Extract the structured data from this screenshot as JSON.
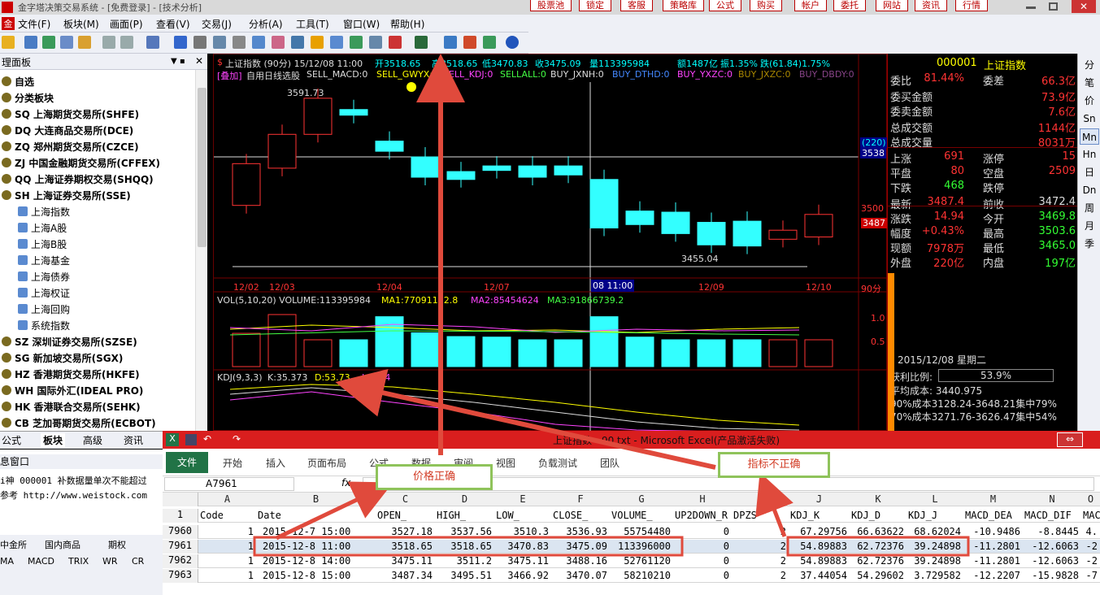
{
  "app": {
    "title": "金字塔决策交易系统 - [免费登录] - [技术分析]"
  },
  "top_buttons": [
    "股票池",
    "锁定",
    "客服",
    "策略库",
    "公式",
    "购买",
    "帐户",
    "委托",
    "网站",
    "资讯",
    "行情"
  ],
  "menu": [
    "文件(F)",
    "板块(M)",
    "画面(P)",
    "查看(V)",
    "交易(J)",
    "分析(A)",
    "工具(T)",
    "窗口(W)",
    "帮助(H)"
  ],
  "panel": {
    "title": "理面板",
    "tree": [
      {
        "label": "自选",
        "bold": true
      },
      {
        "label": "分类板块",
        "bold": true
      },
      {
        "label": "SQ 上海期货交易所(SHFE)",
        "bold": true
      },
      {
        "label": "DQ 大连商品交易所(DCE)",
        "bold": true
      },
      {
        "label": "ZQ 郑州期货交易所(CZCE)",
        "bold": true
      },
      {
        "label": "ZJ 中国金融期货交易所(CFFEX)",
        "bold": true
      },
      {
        "label": "QQ 上海证券期权交易(SHQQ)",
        "bold": true
      },
      {
        "label": "SH 上海证券交易所(SSE)",
        "bold": true
      },
      {
        "label": "上海指数",
        "bold": false
      },
      {
        "label": "上海A股",
        "bold": false
      },
      {
        "label": "上海B股",
        "bold": false
      },
      {
        "label": "上海基金",
        "bold": false
      },
      {
        "label": "上海债券",
        "bold": false
      },
      {
        "label": "上海权证",
        "bold": false
      },
      {
        "label": "上海回购",
        "bold": false
      },
      {
        "label": "系统指数",
        "bold": false
      },
      {
        "label": "SZ 深圳证券交易所(SZSE)",
        "bold": true
      },
      {
        "label": "SG 新加坡交易所(SGX)",
        "bold": true
      },
      {
        "label": "HZ 香港期货交易所(HKFE)",
        "bold": true
      },
      {
        "label": "WH 国际外汇(IDEAL PRO)",
        "bold": true
      },
      {
        "label": "HK 香港联合交易所(SEHK)",
        "bold": true
      },
      {
        "label": "CB 芝加哥期货交易所(ECBOT)",
        "bold": true
      }
    ],
    "tabs": [
      "公式",
      "板块",
      "高级",
      "资讯"
    ],
    "status_title": "息窗口",
    "status_lines": [
      "i神 000001 补数据量单次不能超过",
      "参考 http://www.weistock.com"
    ],
    "bottom_row1": [
      "中金所",
      "国内商品",
      "期权"
    ],
    "bottom_row2": [
      "MA",
      "MACD",
      "TRIX",
      "WR",
      "CR"
    ]
  },
  "chart": {
    "header": "上证指数 (90分) 15/12/08 11:00",
    "open": "开3518.65",
    "high": "高3518.65",
    "low": "低3470.83",
    "close": "收3475.09",
    "vol": "量113395984",
    "amount": "额1487亿",
    "amp": "振1.35%",
    "chg": "跌(61.84)1.75%",
    "indicators": [
      "[叠加]",
      "自用日线选股",
      "SELL_MACD:0",
      "SELL_GWYX:0",
      "SELL_KDJ:0",
      "SELLALL:0",
      "BUY_JXNH:0",
      "BUY_DTHD:0",
      "BUY_YXZC:0",
      "BUY_JXZC:0",
      "BUY_DBDY:0"
    ],
    "price_high_label": "3591.73",
    "price_low_label": "3455.04",
    "price_axis": [
      "3500",
      "3487"
    ],
    "crosshair_badge": [
      "(220)",
      "3538"
    ],
    "dates": [
      "12/02",
      "12/03",
      "12/04",
      "12/07",
      "08 11:00",
      "12/09",
      "12/10"
    ],
    "period": "90分",
    "vol_header": "VOL(5,10,20) VOLUME:113395984",
    "ma1": "MA1:77091152.8",
    "ma2": "MA2:85454624",
    "ma3": "MA3:91866739.2",
    "vol_axis": [
      "1.0",
      "0.5"
    ],
    "kdj": "KDJ(9,3,3)",
    "kdj_k": "K:35.373",
    "kdj_d": "D:53.73",
    "kdj_j": "J:-1.34"
  },
  "chart_data": {
    "type": "candlestick",
    "title": "上证指数 (90分)",
    "series": [
      {
        "o": 3495,
        "c": 3532
      },
      {
        "o": 3528,
        "c": 3558
      },
      {
        "o": 3558,
        "c": 3590
      },
      {
        "o": 3580,
        "c": 3575
      },
      {
        "o": 3552,
        "c": 3543
      },
      {
        "o": 3538,
        "c": 3520
      },
      {
        "o": 3525,
        "c": 3518
      },
      {
        "o": 3530,
        "c": 3526
      },
      {
        "o": 3530,
        "c": 3520
      },
      {
        "o": 3530,
        "c": 3522
      },
      {
        "o": 3518,
        "c": 3475
      },
      {
        "o": 3490,
        "c": 3478
      },
      {
        "o": 3489,
        "c": 3470
      },
      {
        "o": 3480,
        "c": 3460
      },
      {
        "o": 3481,
        "c": 3459
      },
      {
        "o": 3465,
        "c": 3473
      },
      {
        "o": 3467,
        "c": 3487
      }
    ],
    "volume": [
      0.62,
      0.97,
      0.5,
      0.5,
      0.93,
      0.63,
      0.56,
      0.55,
      0.5,
      0.5,
      0.93,
      0.55,
      0.5,
      0.5,
      0.5,
      0.5,
      0.5
    ]
  },
  "quote": {
    "code": "000001",
    "name": "上证指数",
    "rows": [
      [
        "委比",
        "81.44%",
        "委差",
        "66.3亿"
      ],
      [
        "委买金额",
        "",
        "",
        "73.9亿"
      ],
      [
        "委卖金额",
        "",
        "",
        "7.6亿"
      ],
      [
        "总成交额",
        "",
        "",
        "1144亿"
      ],
      [
        "总成交量",
        "",
        "",
        "8031万"
      ],
      [
        "上涨",
        "691",
        "涨停",
        "15"
      ],
      [
        "平盘",
        "80",
        "空盘",
        "2509"
      ],
      [
        "下跌",
        "468",
        "跌停",
        ""
      ],
      [
        "最新",
        "3487.4",
        "前收",
        "3472.4"
      ],
      [
        "涨跌",
        "14.94",
        "今开",
        "3469.8"
      ],
      [
        "幅度",
        "+0.43%",
        "最高",
        "3503.6"
      ],
      [
        "现额",
        "7978万",
        "最低",
        "3465.0"
      ],
      [
        "外盘",
        "220亿",
        "内盘",
        "197亿"
      ]
    ],
    "date": "2015/12/08 星期二",
    "profit_label": "获利比例:",
    "profit": "53.9%",
    "avg": "平均成本: 3440.975",
    "c90": "90%成本3128.24-3648.21集中79%",
    "c70": "70%成本3271.76-3626.47集中54%"
  },
  "right_tabs": [
    "分",
    "笔",
    "价",
    "Sn",
    "Mn",
    "Hn",
    "日",
    "Dn",
    "周",
    "月",
    "季"
  ],
  "excel": {
    "title": "上证指数 - 90.txt - Microsoft Excel(产品激活失败)",
    "tabs": [
      "文件",
      "开始",
      "插入",
      "页面布局",
      "公式",
      "数据",
      "审阅",
      "视图",
      "负载测试",
      "团队"
    ],
    "namebox": "A7961",
    "fx": "fx",
    "columns": [
      "A",
      "B",
      "C",
      "D",
      "E",
      "F",
      "G",
      "H",
      "I",
      "J",
      "K",
      "L",
      "M",
      "N",
      "O"
    ],
    "header": [
      "Code",
      "Date",
      "OPEN_",
      "HIGH_",
      "LOW_",
      "CLOSE_",
      "VOLUME_",
      "UP2DOWN_R",
      "DPZS",
      "KDJ_K",
      "KDJ_D",
      "KDJ_J",
      "MACD_DEA",
      "MACD_DIF",
      "MAC"
    ],
    "rows": [
      [
        "7960",
        "1",
        "2015-12-7 15:00",
        "3527.18",
        "3537.56",
        "3510.3",
        "3536.93",
        "55754480",
        "0",
        "2",
        "67.29756",
        "66.63622",
        "68.62024",
        "-10.9486",
        "-8.8445",
        "4."
      ],
      [
        "7961",
        "1",
        "2015-12-8 11:00",
        "3518.65",
        "3518.65",
        "3470.83",
        "3475.09",
        "113396000",
        "0",
        "2",
        "54.89883",
        "62.72376",
        "39.24898",
        "-11.2801",
        "-12.6063",
        "-2"
      ],
      [
        "7962",
        "1",
        "2015-12-8 14:00",
        "3475.11",
        "3511.2",
        "3475.11",
        "3488.16",
        "52761120",
        "0",
        "2",
        "54.89883",
        "62.72376",
        "39.24898",
        "-11.2801",
        "-12.6063",
        "-2"
      ],
      [
        "7963",
        "1",
        "2015-12-8 15:00",
        "3487.34",
        "3495.51",
        "3466.92",
        "3470.07",
        "58210210",
        "0",
        "2",
        "37.44054",
        "54.29602",
        "3.729582",
        "-12.2207",
        "-15.9828",
        "-7"
      ]
    ]
  },
  "annotations": {
    "price_ok": "价格正确",
    "indicator_bad": "指标不正确"
  },
  "colors": {
    "up": "#ff3333",
    "down": "#33ffff",
    "excel_green": "#217346",
    "excel_title": "#d91e1e",
    "callout_border": "#8fc35b",
    "arrow": "#e04a3c"
  }
}
